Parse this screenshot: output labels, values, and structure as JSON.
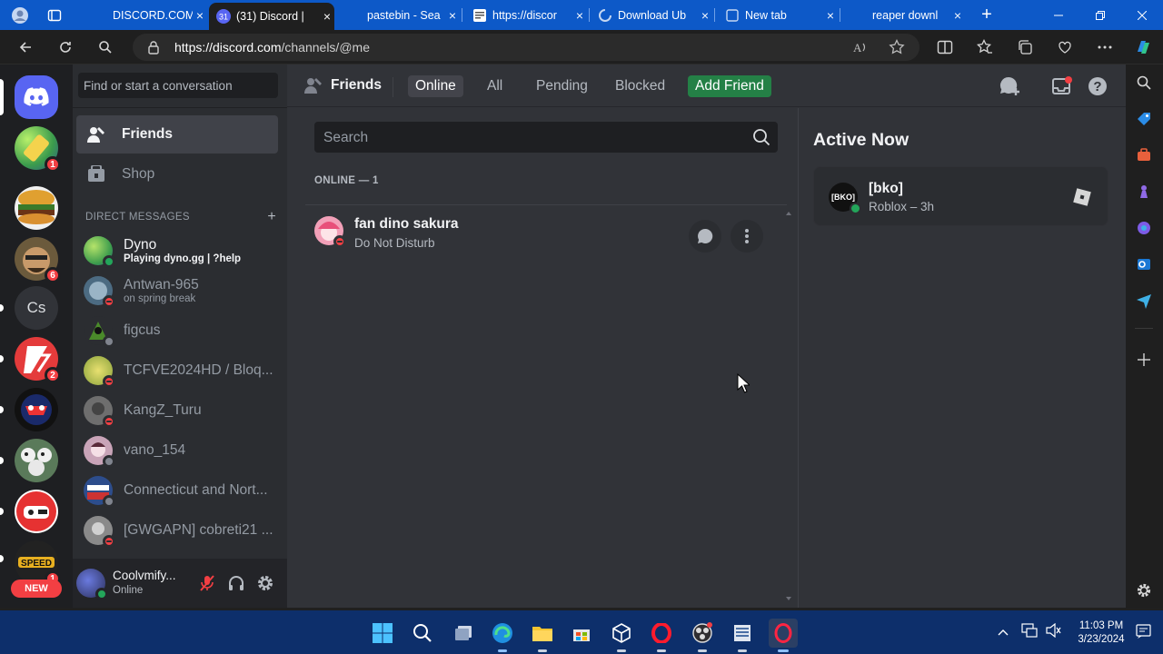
{
  "browser": {
    "tabs": [
      {
        "title": "DISCORD.COM",
        "close": "×"
      },
      {
        "title": "(31) Discord |",
        "close": "×"
      },
      {
        "title": "pastebin - Sea",
        "close": "×"
      },
      {
        "title": "https://discor",
        "close": "×"
      },
      {
        "title": "Download Ub",
        "close": "×"
      },
      {
        "title": "New tab",
        "close": "×"
      },
      {
        "title": "reaper downl",
        "close": "×"
      }
    ],
    "url_host": "https://discord.com",
    "url_path": "/channels/@me"
  },
  "servers": [
    {
      "name": "home",
      "badge": ""
    },
    {
      "name": "server-1",
      "badge": "1"
    },
    {
      "name": "server-2",
      "badge": ""
    },
    {
      "name": "server-3",
      "badge": "6"
    },
    {
      "name": "server-cs",
      "label": "Cs",
      "badge": ""
    },
    {
      "name": "server-5",
      "badge": "2"
    },
    {
      "name": "server-6",
      "badge": ""
    },
    {
      "name": "server-7",
      "badge": ""
    },
    {
      "name": "server-8",
      "badge": ""
    },
    {
      "name": "server-9",
      "badge": "1"
    }
  ],
  "new_label": "NEW",
  "dm_panel": {
    "find_placeholder": "Find or start a conversation",
    "nav": [
      {
        "label": "Friends"
      },
      {
        "label": "Shop"
      }
    ],
    "direct_messages_label": "DIRECT MESSAGES",
    "add_dm": "+",
    "dms": [
      {
        "name": "Dyno",
        "sub": "Playing dyno.gg | ?help",
        "status": "on",
        "color": "#3ba55c"
      },
      {
        "name": "Antwan-965",
        "sub": "on spring break",
        "status": "dnd",
        "color": "#4c6b82"
      },
      {
        "name": "figcus",
        "sub": "",
        "status": "off",
        "color": "#3c3c3c"
      },
      {
        "name": "TCFVE2024HD / Bloq...",
        "sub": "",
        "status": "dnd",
        "color": "#a6b64c"
      },
      {
        "name": "KangZ_Turu",
        "sub": "",
        "status": "dnd",
        "color": "#6e6e6e"
      },
      {
        "name": "vano_154",
        "sub": "",
        "status": "off",
        "color": "#c9a4b8"
      },
      {
        "name": "Connecticut and Nort...",
        "sub": "",
        "status": "off",
        "color": "#2d4d8c"
      },
      {
        "name": "[GWGAPN] cobreti21 ...",
        "sub": "",
        "status": "dnd",
        "color": "#8a8a8a"
      }
    ],
    "user": {
      "name": "Coolvmify...",
      "status": "Online"
    }
  },
  "topbar": {
    "friends_label": "Friends",
    "tabs": [
      "Online",
      "All",
      "Pending",
      "Blocked"
    ],
    "add_friend": "Add Friend"
  },
  "friends": {
    "search_placeholder": "Search",
    "online_header": "ONLINE — 1",
    "list": [
      {
        "name": "fan dino sakura",
        "status": "Do Not Disturb"
      }
    ]
  },
  "active_now": {
    "title": "Active Now",
    "card": {
      "name": "[bko]",
      "avatar_text": "[BKO]",
      "activity": "Roblox – 3h"
    }
  },
  "taskbar": {
    "time": "11:03 PM",
    "date": "3/23/2024"
  },
  "colors": {
    "discord_blurple": "#5865f2",
    "online": "#23a55a",
    "dnd": "#f23f43",
    "add_friend": "#248046"
  }
}
